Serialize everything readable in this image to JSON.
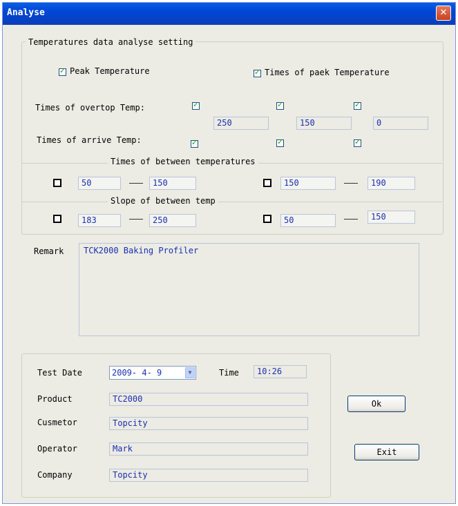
{
  "window": {
    "title": "Analyse",
    "close_glyph": "✕"
  },
  "settings": {
    "legend": "Temperatures data analyse setting",
    "peak_label": "Peak Temperature",
    "peak_checked": true,
    "times_peak_label": "Times of paek Temperature",
    "times_peak_checked": true,
    "overtop_label": "Times of overtop Temp:",
    "overtop_checks": [
      true,
      true,
      true
    ],
    "overtop_values": [
      "250",
      "150",
      "0"
    ],
    "arrive_label": "Times of arrive Temp:",
    "arrive_checks": [
      true,
      true,
      true
    ],
    "between_legend": "Times of between temperatures",
    "between_rows": [
      {
        "checked": false,
        "from": "50",
        "to": "150"
      },
      {
        "checked": false,
        "from": "150",
        "to": "190"
      }
    ],
    "slope_legend": "Slope of between temp",
    "slope_rows": [
      {
        "checked": false,
        "from": "183",
        "to": "250"
      },
      {
        "checked": false,
        "from": "50",
        "to": "150"
      }
    ]
  },
  "remark": {
    "label": "Remark",
    "value": "TCK2000 Baking Profiler"
  },
  "info": {
    "test_date_label": "Test Date",
    "test_date_value": "2009- 4- 9",
    "time_label": "Time",
    "time_value": "10:26",
    "product_label": "Product",
    "product_value": "TC2000",
    "customer_label": "Cusmetor",
    "customer_value": "Topcity",
    "operator_label": "Operator",
    "operator_value": "Mark",
    "company_label": "Company",
    "company_value": "Topcity"
  },
  "buttons": {
    "ok": "Ok",
    "exit": "Exit"
  },
  "icons": {
    "close": "close-icon",
    "dropdown": "chevron-down-icon",
    "check": "checkbox-icon"
  }
}
